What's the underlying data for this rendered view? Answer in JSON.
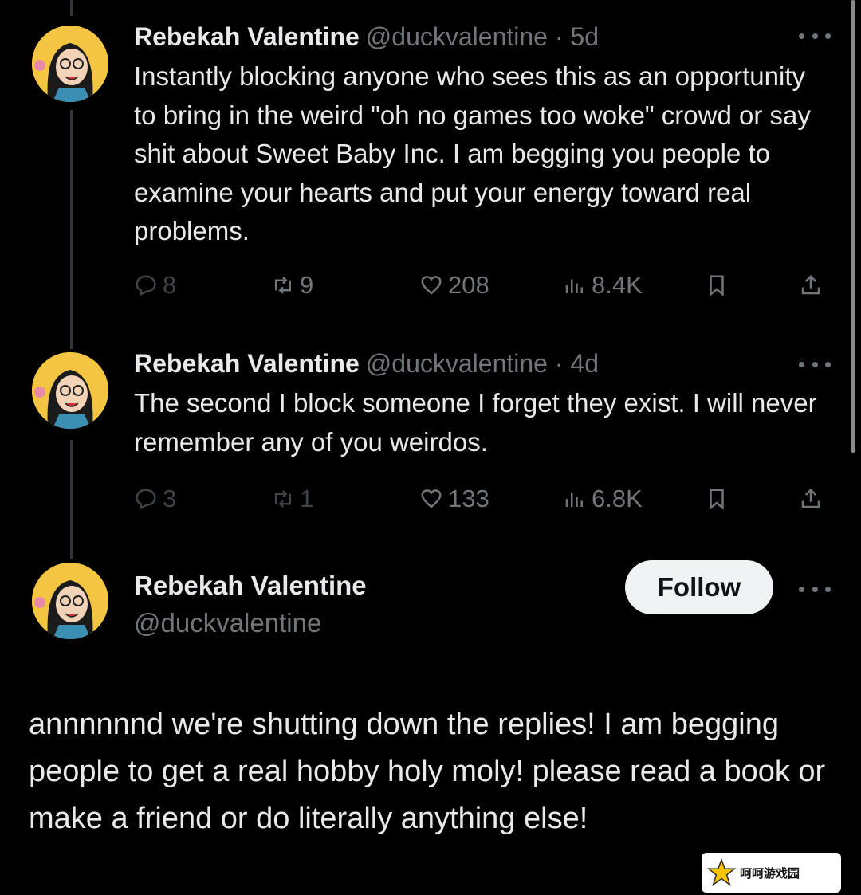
{
  "tweets": [
    {
      "name": "Rebekah Valentine",
      "meta": "@duckvalentine · 5d",
      "text": "Instantly blocking anyone who sees this as an opportunity to bring in the weird \"oh no games too woke\" crowd or say shit about Sweet Baby Inc. I am begging you people to examine your hearts and put your energy toward real problems.",
      "replies": "8",
      "retweets": "9",
      "likes": "208",
      "views": "8.4K"
    },
    {
      "name": "Rebekah Valentine",
      "meta": "@duckvalentine · 4d",
      "text": "The second I block someone I forget they exist. I will never remember any of you weirdos.",
      "replies": "3",
      "retweets": "1",
      "likes": "133",
      "views": "6.8K"
    }
  ],
  "main_tweet": {
    "name": "Rebekah Valentine",
    "handle": "@duckvalentine",
    "follow_label": "Follow",
    "text": "annnnnnd we're shutting down the replies! I am begging people to get a real hobby holy moly! please read a book or make a friend or do literally anything else!"
  },
  "icons": {
    "reply": "reply-icon",
    "retweet": "retweet-icon",
    "like": "heart-icon",
    "views": "views-icon",
    "bookmark": "bookmark-icon",
    "share": "share-icon",
    "more": "more-icon"
  },
  "watermark": {
    "text": "呵呵游戏园"
  },
  "colors": {
    "background": "#000000",
    "text": "#e7e9ea",
    "secondary": "#71767b",
    "follow_bg": "#eff3f4"
  }
}
